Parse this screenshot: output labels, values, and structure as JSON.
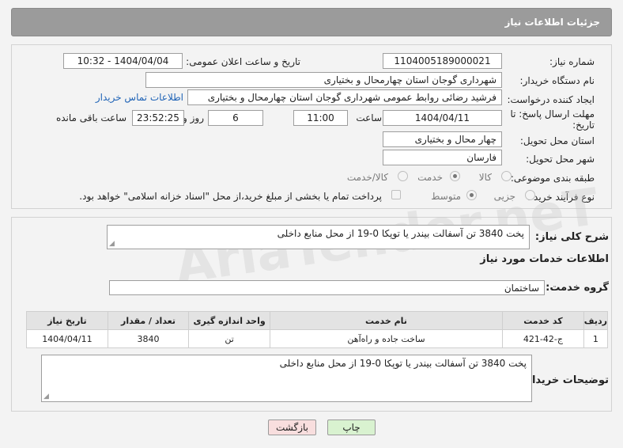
{
  "header": {
    "title": "جزئیات اطلاعات نیاز"
  },
  "form": {
    "need_number_label": "شماره نیاز:",
    "need_number": "1104005189000021",
    "announce_label": "تاریخ و ساعت اعلان عمومی:",
    "announce_value": "1404/04/04 - 10:32",
    "buyer_org_label": "نام دستگاه خریدار:",
    "buyer_org": "شهرداری گوجان استان چهارمحال و بختیاری",
    "requester_label": "ایجاد کننده درخواست:",
    "requester": "فرشید رضائی روابط عمومی شهرداری گوجان استان چهارمحال و بختیاری",
    "contact_link": "اطلاعات تماس خریدار",
    "deadline_label_1": "مهلت ارسال پاسخ: تا",
    "deadline_label_2": "تاریخ:",
    "deadline_date": "1404/04/11",
    "time_label": "ساعت",
    "deadline_time": "11:00",
    "days_value": "6",
    "days_label": "روز و",
    "remaining_time": "23:52:25",
    "remaining_label": "ساعت باقی مانده",
    "province_label": "استان محل تحویل:",
    "province": "چهار محال و بختیاری",
    "city_label": "شهر محل تحویل:",
    "city": "فارسان",
    "category_label": "طبقه بندی موضوعی:",
    "category_options": [
      "کالا",
      "خدمت",
      "کالا/خدمت"
    ],
    "category_selected": "خدمت",
    "process_label": "نوع فرآیند خرید :",
    "process_options": [
      "جزیی",
      "متوسط"
    ],
    "process_selected": "متوسط",
    "payment_note": "پرداخت تمام یا بخشی از مبلغ خرید،از محل \"اسناد خزانه اسلامی\" خواهد بود."
  },
  "summary": {
    "description_label": "شرح کلی نیاز:",
    "description": "پخت 3840 تن آسفالت بیندر یا توپکا 0-19 از محل منابع داخلی",
    "services_heading": "اطلاعات خدمات مورد نیاز",
    "service_group_label": "گروه خدمت:",
    "service_group": "ساختمان"
  },
  "table": {
    "headers": [
      "ردیف",
      "کد خدمت",
      "نام خدمت",
      "واحد اندازه گیری",
      "تعداد / مقدار",
      "تاریخ نیاز"
    ],
    "rows": [
      [
        "1",
        "ج-42-421",
        "ساخت جاده و راه‌آهن",
        "تن",
        "3840",
        "1404/04/11"
      ]
    ]
  },
  "buyer_notes": {
    "label": "توضیحات خریدار:",
    "text": "پخت 3840 تن آسفالت بیندر یا توپکا 0-19 از محل منابع داخلی"
  },
  "buttons": {
    "print": "چاپ",
    "back": "بازگشت"
  },
  "watermark": "AriaTender.neT",
  "colors": {
    "header_bg": "#9b9b9b",
    "link": "#1f63b6",
    "print_btn": "#d9f2d0",
    "back_btn": "#f8dede"
  }
}
